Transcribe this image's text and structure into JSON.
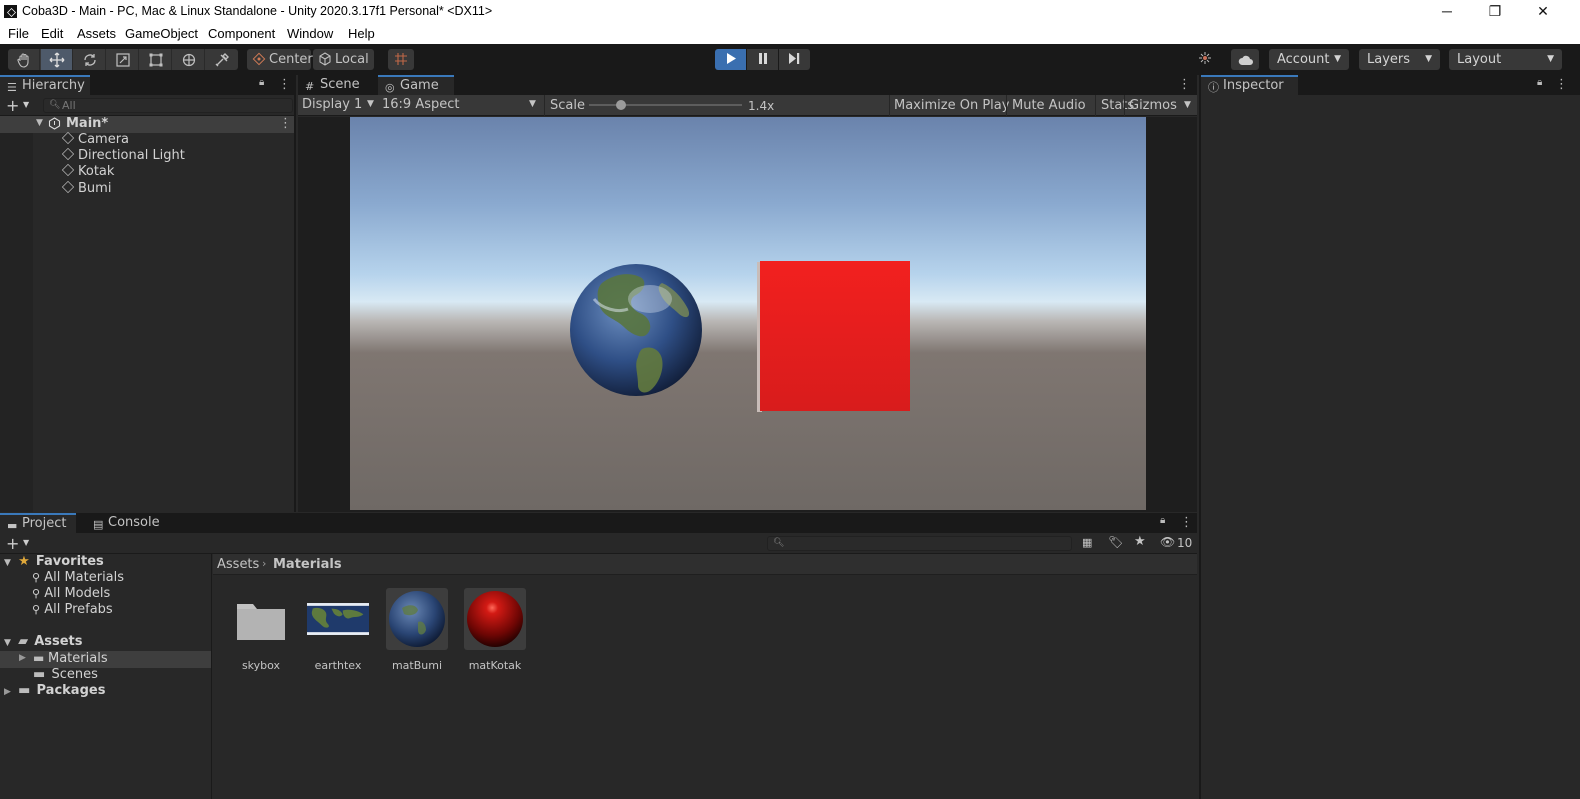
{
  "window": {
    "title": "Coba3D - Main - PC, Mac & Linux Standalone - Unity 2020.3.17f1 Personal* <DX11>",
    "controls": {
      "minimize": "─",
      "maximize": "❐",
      "close": "✕"
    }
  },
  "menu": [
    "File",
    "Edit",
    "Assets",
    "GameObject",
    "Component",
    "Window",
    "Help"
  ],
  "toolbar": {
    "tools": [
      "hand-tool",
      "move-tool",
      "rotate-tool",
      "scale-tool",
      "rect-tool",
      "transform-tool",
      "custom-tool"
    ],
    "active_tool": "move-tool",
    "pivot_mode": "Center",
    "pivot_rotation": "Local",
    "play_state": "playing",
    "account_label": "Account",
    "layers_label": "Layers",
    "layout_label": "Layout"
  },
  "hierarchy": {
    "tab": "Hierarchy",
    "search_placeholder": "All",
    "scene": "Main*",
    "objects": [
      "Camera",
      "Directional Light",
      "Kotak",
      "Bumi"
    ]
  },
  "views": {
    "tabs": [
      "Scene",
      "Game"
    ],
    "active_tab": "Game",
    "display": "Display 1",
    "aspect": "16:9 Aspect",
    "scale_label": "Scale",
    "scale_value": "1.4x",
    "scale_fraction": 0.21,
    "options": [
      "Maximize On Play",
      "Mute Audio",
      "Stats",
      "Gizmos"
    ]
  },
  "inspector": {
    "tab": "Inspector"
  },
  "project": {
    "tabs": [
      "Project",
      "Console"
    ],
    "active_tab": "Project",
    "hidden_count": "10",
    "favorites_label": "Favorites",
    "favorites": [
      "All Materials",
      "All Models",
      "All Prefabs"
    ],
    "assets_label": "Assets",
    "asset_folders": [
      "Materials",
      "Scenes"
    ],
    "selected_folder": "Materials",
    "packages_label": "Packages",
    "breadcrumb": [
      "Assets",
      "Materials"
    ],
    "items": [
      {
        "name": "skybox",
        "kind": "folder"
      },
      {
        "name": "earthtex",
        "kind": "texture"
      },
      {
        "name": "matBumi",
        "kind": "material-earth"
      },
      {
        "name": "matKotak",
        "kind": "material-red"
      }
    ]
  },
  "colors": {
    "accent": "#3a79bb",
    "play_active": "#3a6fb0",
    "cube_red": "#e51f1f",
    "panel_bg": "#282828",
    "tab_bg": "#191919"
  }
}
